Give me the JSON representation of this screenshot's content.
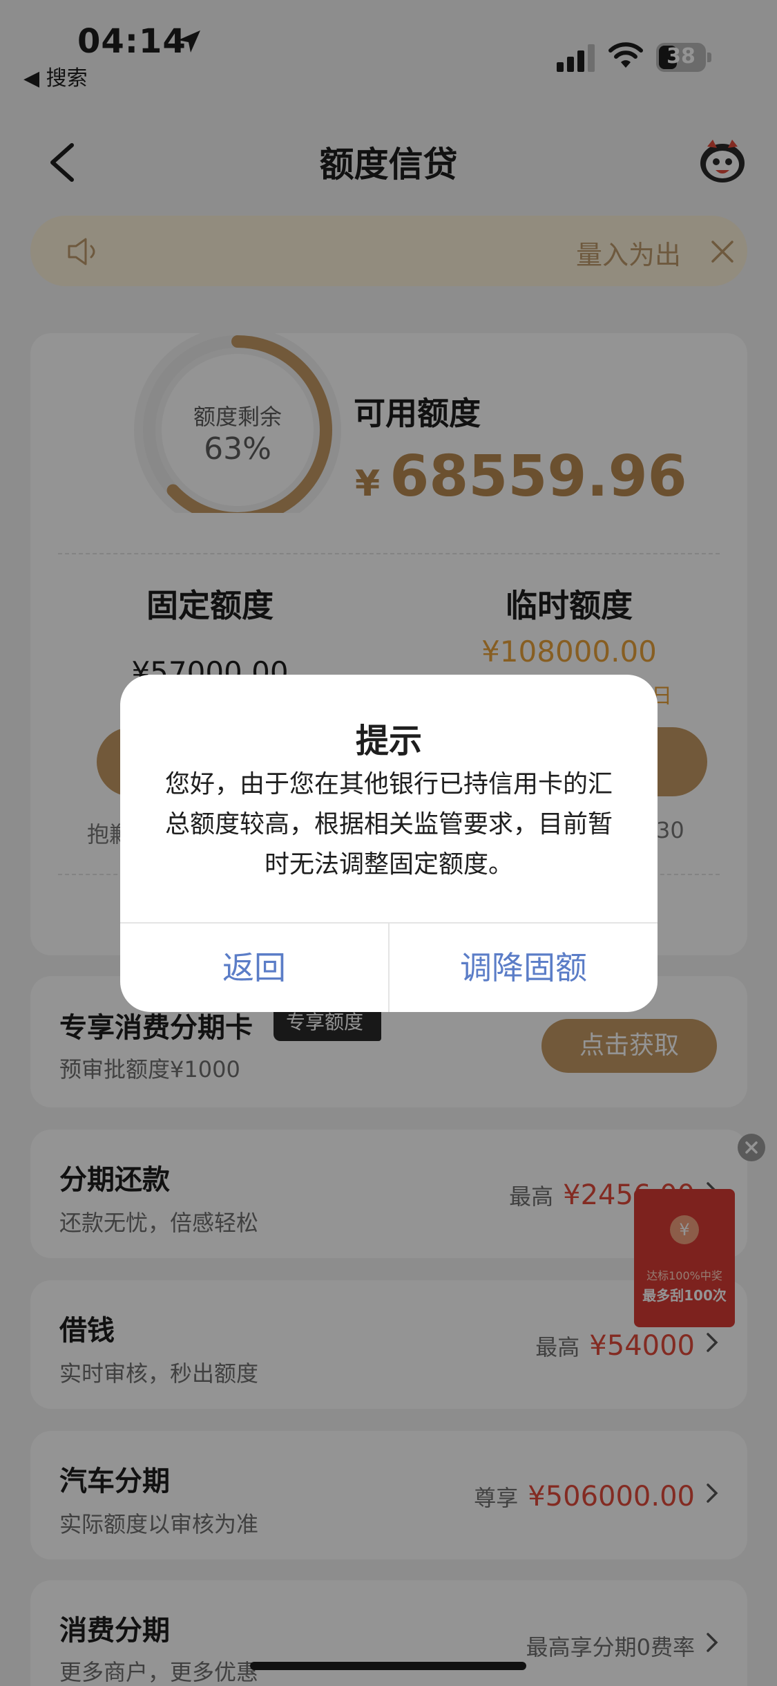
{
  "status_bar": {
    "time": "04:14",
    "back_app": "◀ 搜索",
    "battery": "38"
  },
  "header": {
    "title": "额度信贷"
  },
  "notice": {
    "text": "量入为出"
  },
  "quota": {
    "donut_label": "额度剩余",
    "donut_percent": "63%",
    "remaining_fraction": 0.63,
    "available_label": "可用额度",
    "currency": "¥",
    "available_amount": "68559.96",
    "fixed_label": "固定额度",
    "fixed_amount": "¥57000.00",
    "temp_label": "临时额度",
    "temp_amount": "¥108000.00",
    "temp_date_fragment": "4日",
    "left_caption": "抱歉",
    "right_caption": "30"
  },
  "exclusive_card": {
    "title": "专享消费分期卡",
    "badge": "专享额度",
    "subtitle": "预审批额度¥1000",
    "button": "点击获取"
  },
  "installment_card": {
    "title": "分期还款",
    "subtitle": "还款无忧，倍感轻松",
    "prefix": "最高",
    "amount": "¥2456.00"
  },
  "borrow_card": {
    "title": "借钱",
    "subtitle": "实时审核，秒出额度",
    "prefix": "最高",
    "amount": "¥54000"
  },
  "car_card": {
    "title": "汽车分期",
    "subtitle": "实际额度以审核为准",
    "prefix": "尊享",
    "amount": "¥506000.00"
  },
  "consume_card": {
    "title": "消费分期",
    "subtitle": "更多商户，更多优惠",
    "right_text": "最高享分期0费率"
  },
  "red_packet": {
    "coin": "¥",
    "line1": "达标100%中奖",
    "line2": "最多刮100次"
  },
  "modal": {
    "title": "提示",
    "body": "您好，由于您在其他银行已持信用卡的汇总额度较高，根据相关监管要求，目前暂时无法调整固定额度。",
    "cancel": "返回",
    "confirm": "调降固额"
  },
  "colors": {
    "gold": "#b98a52",
    "accent_red": "#e24a3b",
    "temp_orange": "#e8a23c",
    "link_blue": "#5b7dc7"
  }
}
